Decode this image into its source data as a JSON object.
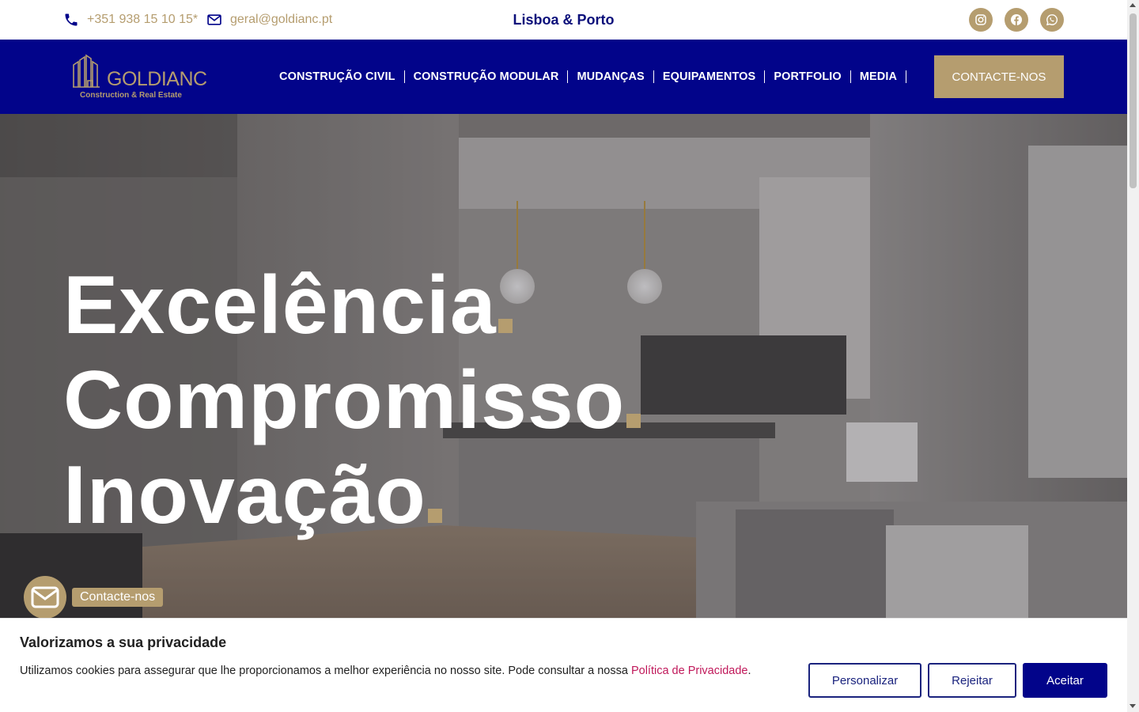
{
  "topbar": {
    "phone": "+351 938 15 10 15*",
    "email": "geral@goldianc.pt",
    "location": "Lisboa & Porto",
    "social": [
      "instagram-icon",
      "facebook-icon",
      "whatsapp-icon"
    ]
  },
  "brand": {
    "name": "GOLDIANC",
    "tagline": "Construction & Real Estate"
  },
  "nav": {
    "items": [
      {
        "label": "CONSTRUÇÃO CIVIL"
      },
      {
        "label": "CONSTRUÇÃO MODULAR"
      },
      {
        "label": "MUDANÇAS"
      },
      {
        "label": "EQUIPAMENTOS"
      },
      {
        "label": "PORTFOLIO"
      },
      {
        "label": "MEDIA"
      }
    ],
    "cta": "CONTACTE-NOS"
  },
  "hero": {
    "lines": [
      "Excelência",
      "Compromisso",
      "Inovação"
    ],
    "float_contact": "Contacte-nos"
  },
  "cookie": {
    "title": "Valorizamos a sua privacidade",
    "text": "Utilizamos cookies para assegurar que lhe proporcionamos a melhor experiência no nosso site. Pode consultar a nossa ",
    "link": "Política de Privacidade",
    "text_end": ".",
    "buttons": {
      "customize": "Personalizar",
      "reject": "Rejeitar",
      "accept": "Aceitar"
    }
  },
  "colors": {
    "navy": "#02048a",
    "gold": "#b59d6f",
    "link": "#c0185a"
  }
}
